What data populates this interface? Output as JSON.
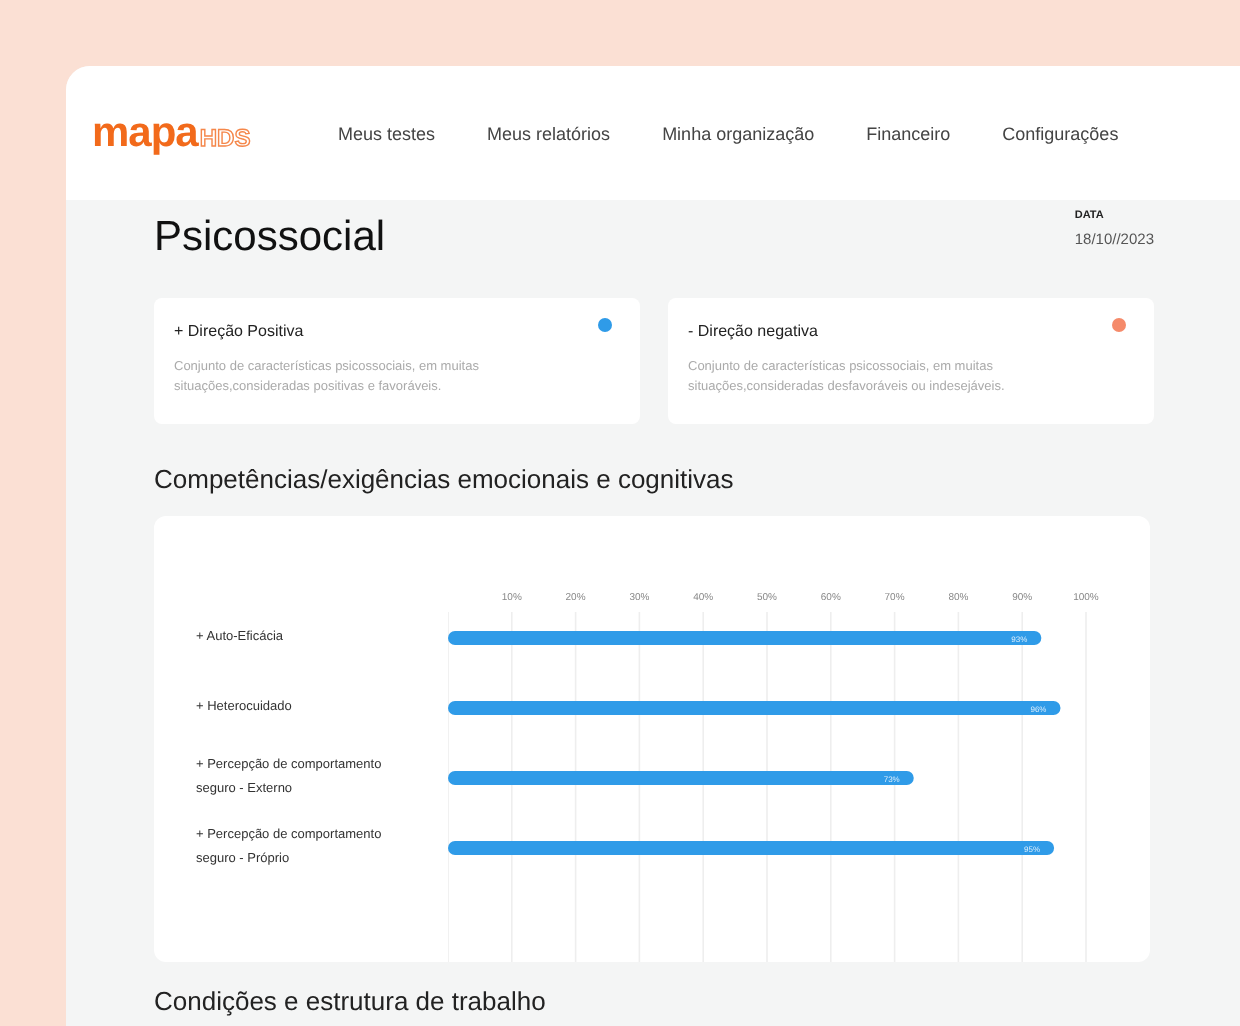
{
  "logo": {
    "name": "mapa",
    "suffix": "HDS"
  },
  "nav": [
    {
      "label": "Meus testes"
    },
    {
      "label": "Meus relatórios"
    },
    {
      "label": "Minha organização"
    },
    {
      "label": "Financeiro"
    },
    {
      "label": "Configurações"
    }
  ],
  "page": {
    "title": "Psicossocial",
    "date_label": "DATA",
    "date": "18/10//2023"
  },
  "legend": [
    {
      "title": "+  Direção Positiva",
      "description": "Conjunto de características psicossociais, em muitas situações,consideradas positivas e favoráveis.",
      "color": "#2f9be8"
    },
    {
      "title": "- Direção negativa",
      "description": "Conjunto de características psicossociais, em muitas situações,consideradas desfavoráveis ou indesejáveis.",
      "color": "#f58a6a"
    }
  ],
  "section": {
    "title": "Competências/exigências emocionais e cognitivas",
    "chart_data": {
      "type": "bar",
      "orientation": "horizontal",
      "categories": [
        "+ Auto-Eficácia",
        "+ Heterocuidado",
        "+ Percepção de comportamento seguro - Externo",
        "+ Percepção de comportamento seguro - Próprio"
      ],
      "values": [
        93,
        96,
        73,
        95
      ],
      "xlim": [
        0,
        100
      ],
      "grid": true,
      "xticks": [
        {
          "value": 10,
          "label": "10%"
        },
        {
          "value": 20,
          "label": "20%"
        },
        {
          "value": 30,
          "label": "30%"
        },
        {
          "value": 40,
          "label": "40%"
        },
        {
          "value": 50,
          "label": "50%"
        },
        {
          "value": 60,
          "label": "60%"
        },
        {
          "value": 70,
          "label": "70%"
        },
        {
          "value": 80,
          "label": "80%"
        },
        {
          "value": 90,
          "label": "90%"
        },
        {
          "value": 100,
          "label": "100%"
        }
      ],
      "value_labels": [
        "93%",
        "96%",
        "73%",
        "95%"
      ]
    }
  },
  "next_section": {
    "title": "Condições e estrutura de trabalho"
  }
}
